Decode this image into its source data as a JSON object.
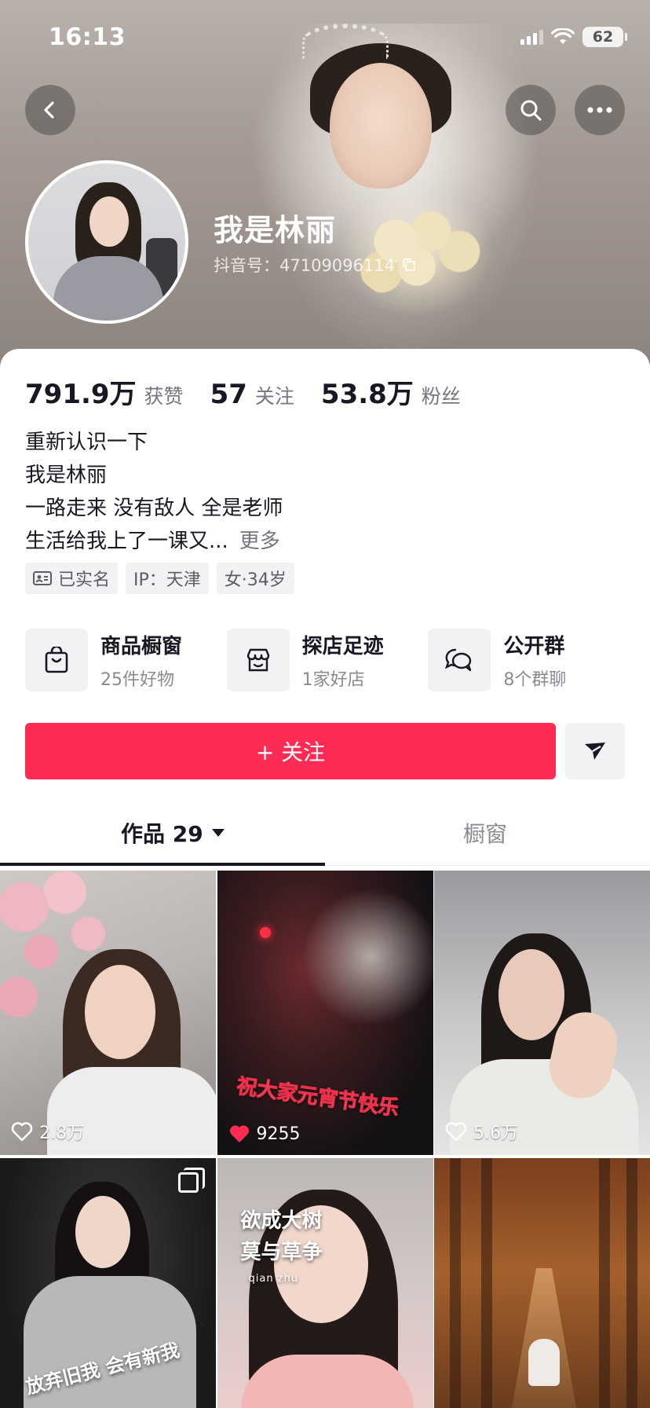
{
  "status_bar": {
    "time": "16:13",
    "battery": "62"
  },
  "profile": {
    "name": "我是林丽",
    "douyin_id": "抖音号：47109096114"
  },
  "stats": [
    {
      "value": "791.9万",
      "label": "获赞"
    },
    {
      "value": "57",
      "label": "关注"
    },
    {
      "value": "53.8万",
      "label": "粉丝"
    }
  ],
  "bio": {
    "lines": [
      "重新认识一下",
      "我是林丽",
      "一路走来 没有敌人 全是老师",
      "生活给我上了一课又..."
    ],
    "more": "更多"
  },
  "tags": [
    "已实名",
    "IP：天津",
    "女·34岁"
  ],
  "services": [
    {
      "title": "商品橱窗",
      "subtitle": "25件好物",
      "icon": "shopping-bag-icon"
    },
    {
      "title": "探店足迹",
      "subtitle": "1家好店",
      "icon": "store-icon"
    },
    {
      "title": "公开群",
      "subtitle": "8个群聊",
      "icon": "group-chat-icon"
    }
  ],
  "actions": {
    "follow": "+ 关注"
  },
  "tabs": {
    "works": "作品 29",
    "shop": "橱窗"
  },
  "videos": [
    {
      "likes": "2.8万",
      "liked": false,
      "caption": ""
    },
    {
      "likes": "9255",
      "liked": true,
      "caption": "祝大家元宵节快乐"
    },
    {
      "likes": "5.6万",
      "liked": false,
      "caption": ""
    },
    {
      "likes": "",
      "liked": false,
      "caption": "放弃旧我 会有新我"
    },
    {
      "likes": "",
      "liked": false,
      "caption": "欲成大树\n莫与草争",
      "caption_sub": "qian zhu"
    },
    {
      "likes": "",
      "liked": false,
      "caption": ""
    }
  ],
  "colors": {
    "accent": "#fe2c55",
    "text": "#161823",
    "muted": "#757780"
  }
}
